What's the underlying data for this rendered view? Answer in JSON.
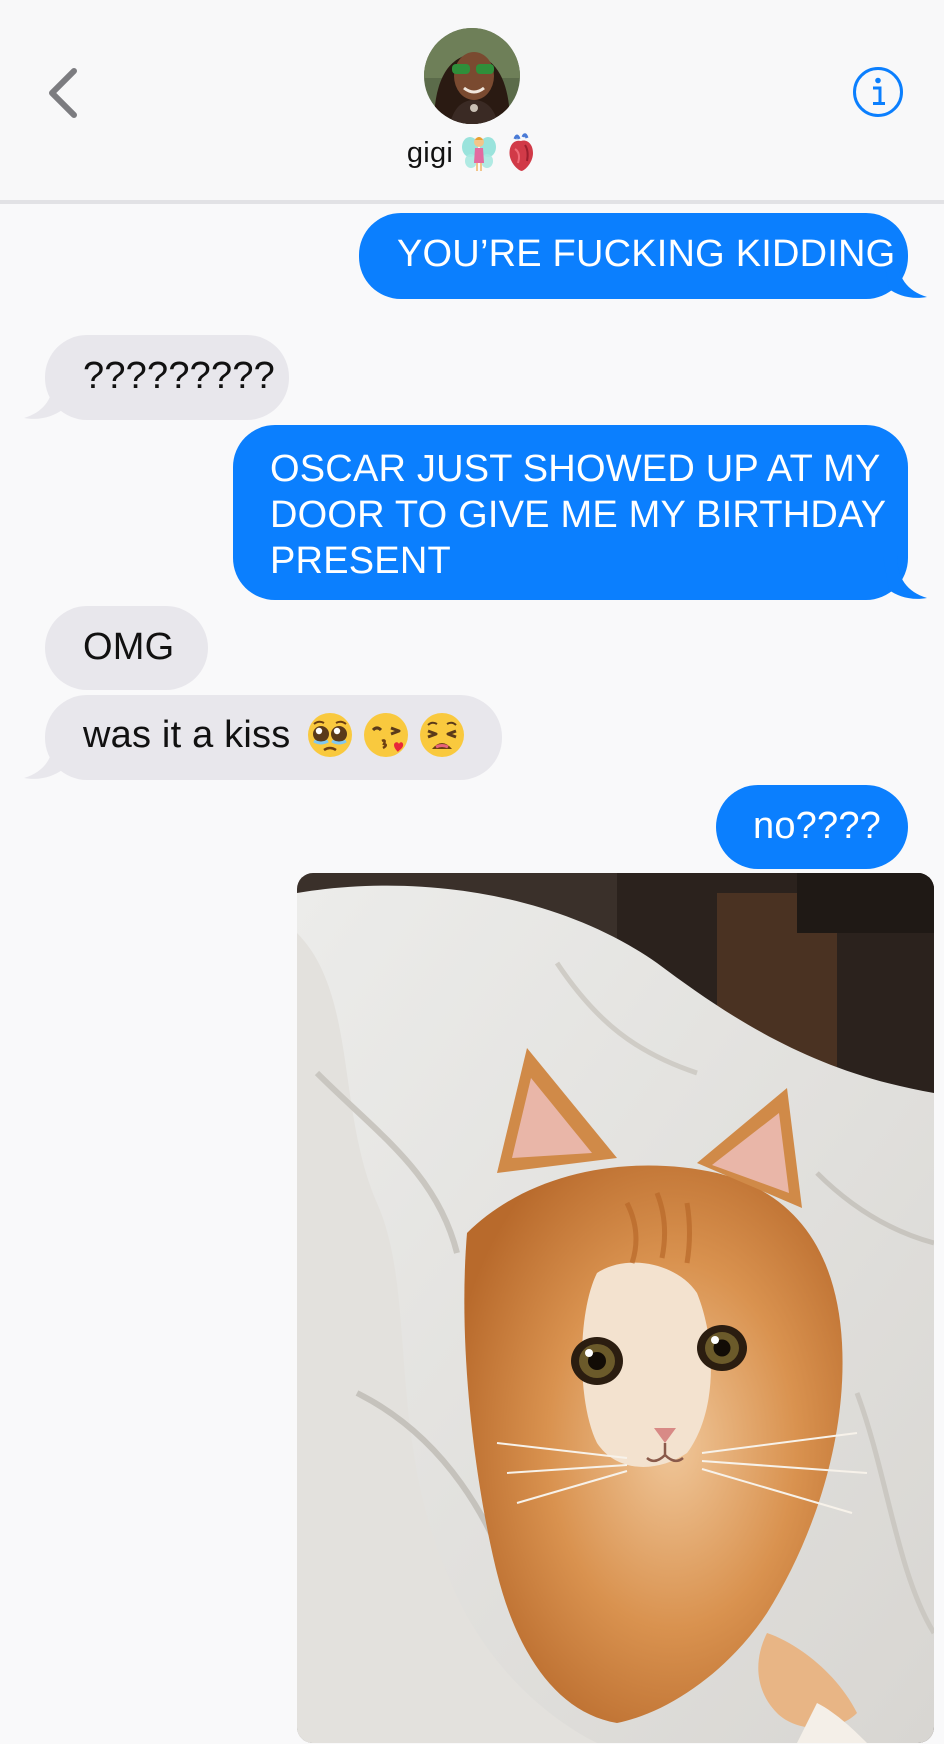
{
  "header": {
    "back_icon": "chevron-left-icon",
    "contact_name": "gigi",
    "name_emojis": [
      "fairy-emoji",
      "anatomical-heart-emoji"
    ],
    "avatar": "contact-avatar",
    "info_icon": "info-icon",
    "accent": "#0b7ffe"
  },
  "messages": [
    {
      "side": "out",
      "text": "YOU’RE FUCKING KIDDING"
    },
    {
      "side": "in",
      "text": "?????????"
    },
    {
      "side": "out",
      "lines": [
        "OSCAR JUST SHOWED UP AT MY",
        "DOOR TO GIVE ME MY BIRTHDAY",
        "PRESENT"
      ]
    },
    {
      "side": "in",
      "text": "OMG"
    },
    {
      "side": "in",
      "text": "was it a kiss",
      "emojis": [
        "pleading-face-emoji",
        "kissing-heart-face-emoji",
        "weary-face-emoji"
      ]
    },
    {
      "side": "out",
      "text": "no????"
    },
    {
      "side": "out",
      "attachment": "photo-orange-kitten-on-white-blanket"
    }
  ],
  "colors": {
    "outgoing_bubble": "#0b7ffe",
    "incoming_bubble": "#e8e7ec",
    "background": "#f9f9fa"
  }
}
